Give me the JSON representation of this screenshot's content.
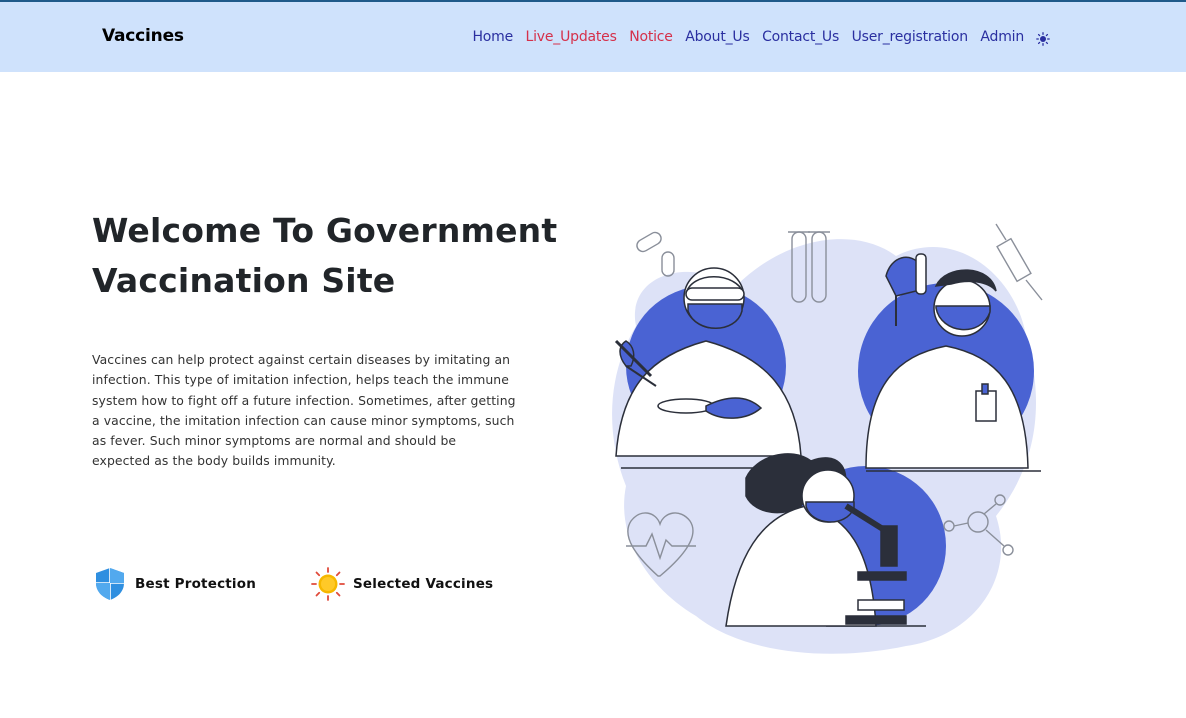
{
  "navbar": {
    "brand": "Vaccines",
    "links": [
      {
        "label": "Home",
        "highlight": false
      },
      {
        "label": "Live_Updates",
        "highlight": true
      },
      {
        "label": "Notice",
        "highlight": true
      },
      {
        "label": "About_Us",
        "highlight": false
      },
      {
        "label": "Contact_Us",
        "highlight": false
      },
      {
        "label": "User_registration",
        "highlight": false
      },
      {
        "label": "Admin",
        "highlight": false
      }
    ],
    "theme_icon": "sun-icon"
  },
  "hero": {
    "title_line1": "Welcome To Government",
    "title_line2": "Vaccination Site",
    "paragraph_lines": [
      "Vaccines can help protect against certain diseases by imitating an",
      "infection. This type of imitation infection, helps teach the immune",
      "system how to fight off a future infection. Sometimes, after getting",
      "a vaccine, the imitation infection can cause minor symptoms, such",
      "as fever. Such minor symptoms are normal and should be",
      "expected as the body builds immunity."
    ]
  },
  "features": [
    {
      "label": "Best Protection",
      "icon": "shield-icon"
    },
    {
      "label": "Selected Vaccines",
      "icon": "sun-icon"
    }
  ],
  "illustration": {
    "icon": "lab-scientists-illustration"
  },
  "colors": {
    "navbar_bg": "#cfe2fc",
    "nav_link": "#2a2fa0",
    "nav_link_highlight": "#d5304a",
    "accent_blue": "#4a63d3",
    "blob_light": "#dde2f7",
    "shield_blue": "#2f8fe0",
    "sun_yellow": "#f6b800"
  }
}
